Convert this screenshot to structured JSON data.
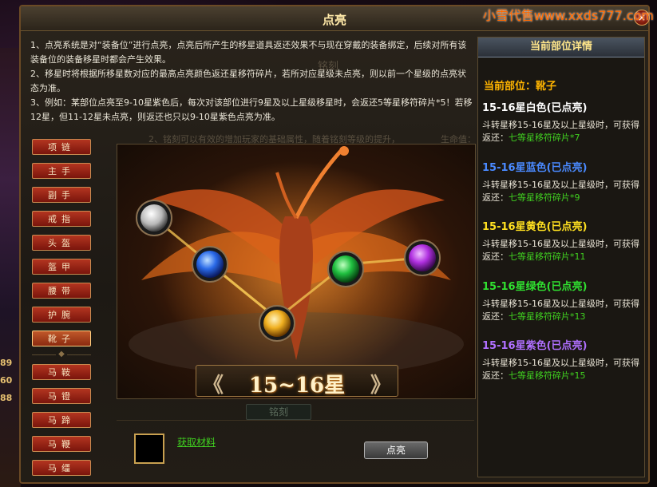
{
  "watermark": "小雪代售www.xxds777.com",
  "window": {
    "title": "点亮",
    "close_label": "×"
  },
  "description": "1、点亮系统是对“装备位”进行点亮，点亮后所产生的移星道具返还效果不与现在穿戴的装备绑定，后续对所有该装备位的装备移星时都会产生效果。\n2、移星时将根据所移星数对应的最高点亮颜色返还星移符碎片，若所对应星级未点亮，则以前一个星级的点亮状态为准。\n3、例如：某部位点亮至9-10星紫色后，每次对该部位进行9星及以上星级移星时，会返还5等星移符碎片*5！若移12星，但11-12星未点亮，则返还也只以9-10星紫色点亮为准。",
  "background_fragments": {
    "ming_ke": "铭刻",
    "hint": "2、铭刻可以有效的增加玩家的基础属性，随着铭刻等级的提升，",
    "life": "生命值：",
    "ming_ke_btn": "铭刻",
    "left_numbers": [
      "89",
      "60",
      "88"
    ]
  },
  "sidebar": {
    "items": [
      {
        "label": "项链",
        "active": false
      },
      {
        "label": "主手",
        "active": false
      },
      {
        "label": "副手",
        "active": false
      },
      {
        "label": "戒指",
        "active": false
      },
      {
        "label": "头盔",
        "active": false
      },
      {
        "label": "盔甲",
        "active": false
      },
      {
        "label": "腰带",
        "active": false
      },
      {
        "label": "护腕",
        "active": false
      },
      {
        "label": "靴子",
        "active": true
      },
      {
        "label": "马鞍",
        "active": false
      },
      {
        "label": "马镫",
        "active": false
      },
      {
        "label": "马蹄",
        "active": false
      },
      {
        "label": "马鞭",
        "active": false
      },
      {
        "label": "马缰",
        "active": false
      }
    ],
    "divider_glyph": "◆"
  },
  "scene": {
    "star_range": "15~16星",
    "arrow_left": "《",
    "arrow_right": "》",
    "orbs": [
      {
        "color": "white",
        "hex": "#e8e8e8"
      },
      {
        "color": "blue",
        "hex": "#2a6ae8"
      },
      {
        "color": "yellow",
        "hex": "#f0b020"
      },
      {
        "color": "green",
        "hex": "#20c040"
      },
      {
        "color": "purple",
        "hex": "#b030e0"
      }
    ]
  },
  "bottom": {
    "material_link": "获取材料",
    "light_button": "点亮"
  },
  "detail_panel": {
    "header": "当前部位详情",
    "current_part": "当前部位：靴子",
    "tiers": [
      {
        "title": "15-16星白色(已点亮)",
        "color": "#ffffff",
        "desc": "斗转星移15-16星及以上星级时，可获得返还：",
        "reward": "七等星移符碎片*7"
      },
      {
        "title": "15-16星蓝色(已点亮)",
        "color": "#4a8aff",
        "desc": "斗转星移15-16星及以上星级时，可获得返还：",
        "reward": "七等星移符碎片*9"
      },
      {
        "title": "15-16星黄色(已点亮)",
        "color": "#ffe020",
        "desc": "斗转星移15-16星及以上星级时，可获得返还：",
        "reward": "七等星移符碎片*11"
      },
      {
        "title": "15-16星绿色(已点亮)",
        "color": "#30e030",
        "desc": "斗转星移15-16星及以上星级时，可获得返还：",
        "reward": "七等星移符碎片*13"
      },
      {
        "title": "15-16星紫色(已点亮)",
        "color": "#b070ff",
        "desc": "斗转星移15-16星及以上星级时，可获得返还：",
        "reward": "七等星移符碎片*15"
      }
    ]
  }
}
